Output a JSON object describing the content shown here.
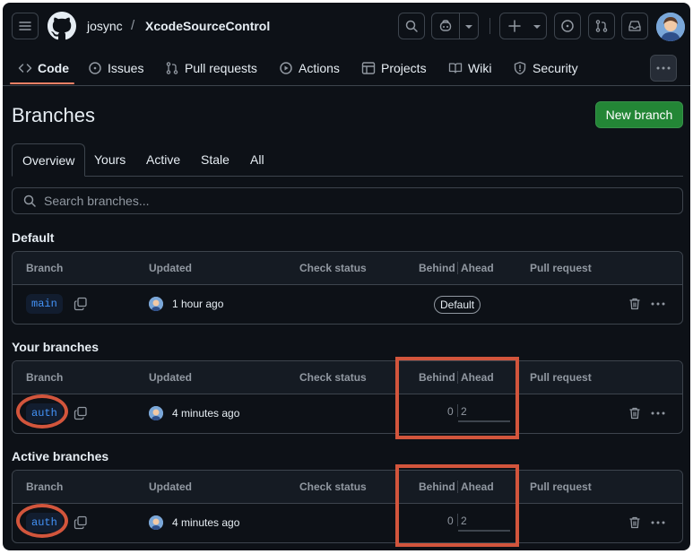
{
  "header": {
    "owner": "josync",
    "separator": "/",
    "repo": "XcodeSourceControl"
  },
  "nav": {
    "tabs": [
      {
        "label": "Code",
        "icon": "code-icon"
      },
      {
        "label": "Issues",
        "icon": "issue-opened-icon"
      },
      {
        "label": "Pull requests",
        "icon": "git-pull-request-icon"
      },
      {
        "label": "Actions",
        "icon": "play-icon"
      },
      {
        "label": "Projects",
        "icon": "table-icon"
      },
      {
        "label": "Wiki",
        "icon": "book-icon"
      },
      {
        "label": "Security",
        "icon": "shield-icon"
      }
    ],
    "active": "Code"
  },
  "page": {
    "title": "Branches",
    "new_branch_label": "New branch"
  },
  "filter_tabs": [
    "Overview",
    "Yours",
    "Active",
    "Stale",
    "All"
  ],
  "filter_active": "Overview",
  "search": {
    "placeholder": "Search branches..."
  },
  "columns": {
    "branch": "Branch",
    "updated": "Updated",
    "check_status": "Check status",
    "behind": "Behind",
    "ahead": "Ahead",
    "pull_request": "Pull request"
  },
  "sections": [
    {
      "title": "Default",
      "rows": [
        {
          "branch": "main",
          "updated": "1 hour ago",
          "badge": "Default"
        }
      ]
    },
    {
      "title": "Your branches",
      "rows": [
        {
          "branch": "auth",
          "updated": "4 minutes ago",
          "behind": "0",
          "ahead": "2"
        }
      ]
    },
    {
      "title": "Active branches",
      "rows": [
        {
          "branch": "auth",
          "updated": "4 minutes ago",
          "behind": "0",
          "ahead": "2"
        }
      ]
    }
  ],
  "colors": {
    "background": "#0d1117",
    "accent_underline": "#f78166",
    "primary_button": "#238636",
    "branch_text": "#4493f8",
    "annotation": "#d2553c"
  }
}
